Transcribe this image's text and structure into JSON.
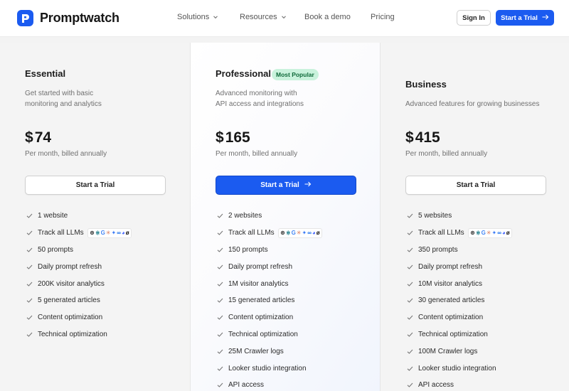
{
  "brand": {
    "name": "Promptwatch",
    "color": "#1b5bf0"
  },
  "nav": {
    "links": [
      {
        "label": "Solutions",
        "has_dropdown": true
      },
      {
        "label": "Resources",
        "has_dropdown": true
      },
      {
        "label": "Book a demo",
        "has_dropdown": false
      },
      {
        "label": "Pricing",
        "has_dropdown": false
      }
    ],
    "sign_in": "Sign In",
    "start_trial": "Start a Trial"
  },
  "plans": [
    {
      "name": "Essential",
      "badge": "",
      "description": [
        "Get started with basic",
        "monitoring and analytics"
      ],
      "currency": "$",
      "price": "74",
      "billing": "Per month, billed annually",
      "cta": "Start a Trial",
      "features": [
        "1 website",
        "Track all LLMs",
        "50 prompts",
        "Daily prompt refresh",
        "200K visitor analytics",
        "5 generated articles",
        "Content optimization",
        "Technical optimization"
      ]
    },
    {
      "name": "Professional",
      "badge": "Most Popular",
      "description": [
        "Advanced monitoring with",
        "API access and integrations"
      ],
      "currency": "$",
      "price": "165",
      "billing": "Per month, billed annually",
      "cta": "Start a Trial",
      "features": [
        "2 websites",
        "Track all LLMs",
        "150 prompts",
        "Daily prompt refresh",
        "1M visitor analytics",
        "15 generated articles",
        "Content optimization",
        "Technical optimization",
        "25M Crawler logs",
        "Looker studio integration",
        "API access"
      ]
    },
    {
      "name": "Business",
      "badge": "",
      "description": [
        "Advanced features for growing businesses"
      ],
      "currency": "$",
      "price": "415",
      "billing": "Per month, billed annually",
      "cta": "Start a Trial",
      "features": [
        "5 websites",
        "Track all LLMs",
        "350 prompts",
        "Daily prompt refresh",
        "10M visitor analytics",
        "30 generated articles",
        "Content optimization",
        "Technical optimization",
        "100M Crawler logs",
        "Looker studio integration",
        "API access"
      ]
    }
  ],
  "llm_icons": [
    {
      "name": "openai-icon",
      "glyph": "⊛",
      "color": "#222222"
    },
    {
      "name": "perplexity-icon",
      "glyph": "⋇",
      "color": "#20808d"
    },
    {
      "name": "google-icon",
      "glyph": "G",
      "color": "#4285f4"
    },
    {
      "name": "claude-icon",
      "glyph": "✳",
      "color": "#d97757"
    },
    {
      "name": "gemini-icon",
      "glyph": "✦",
      "color": "#3b7bf6"
    },
    {
      "name": "meta-icon",
      "glyph": "∞",
      "color": "#0a66e8"
    },
    {
      "name": "deepseek-icon",
      "glyph": "◕",
      "color": "#4d6bfe"
    },
    {
      "name": "grok-icon",
      "glyph": "ø",
      "color": "#111111"
    }
  ]
}
